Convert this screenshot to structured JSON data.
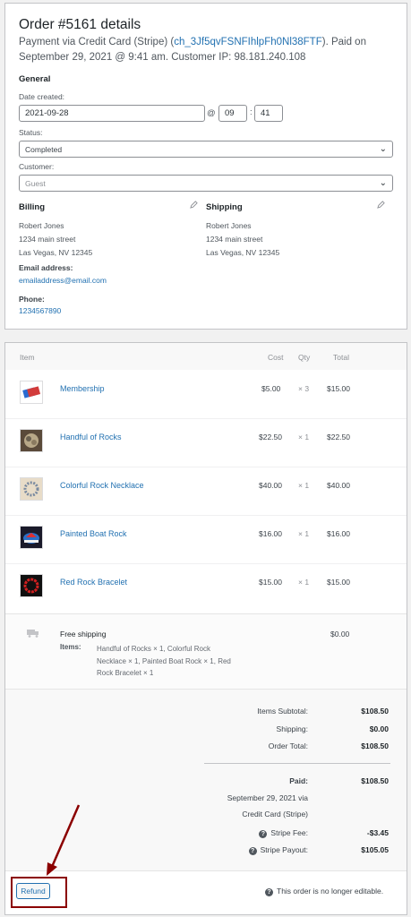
{
  "order": {
    "title": "Order #5161 details",
    "payment_prefix": "Payment via Credit Card (Stripe) (",
    "charge_id": "ch_3Jf5qvFSNFIhlpFh0Nl38FTF",
    "payment_suffix": "). Paid on September 29, 2021 @ 9:41 am. Customer IP: 98.181.240.108"
  },
  "general": {
    "heading": "General",
    "date_label": "Date created:",
    "date_value": "2021-09-28",
    "at": "@",
    "hour": "09",
    "colon": ":",
    "minute": "41",
    "status_label": "Status:",
    "status_value": "Completed",
    "customer_label": "Customer:",
    "customer_value": "Guest"
  },
  "billing": {
    "heading": "Billing",
    "name": "Robert Jones",
    "street": "1234 main street",
    "city": "Las Vegas, NV 12345",
    "email_label": "Email address:",
    "email": "emailaddress@email.com",
    "phone_label": "Phone:",
    "phone": "1234567890"
  },
  "shipping_addr": {
    "heading": "Shipping",
    "name": "Robert Jones",
    "street": "1234 main street",
    "city": "Las Vegas, NV 12345"
  },
  "items_table": {
    "col_item": "Item",
    "col_cost": "Cost",
    "col_qty": "Qty",
    "col_total": "Total",
    "rows": [
      {
        "name": "Membership",
        "cost": "$5.00",
        "qty": "× 3",
        "total": "$15.00"
      },
      {
        "name": "Handful of Rocks",
        "cost": "$22.50",
        "qty": "× 1",
        "total": "$22.50"
      },
      {
        "name": "Colorful Rock Necklace",
        "cost": "$40.00",
        "qty": "× 1",
        "total": "$40.00"
      },
      {
        "name": "Painted Boat Rock",
        "cost": "$16.00",
        "qty": "× 1",
        "total": "$16.00"
      },
      {
        "name": "Red Rock Bracelet",
        "cost": "$15.00",
        "qty": "× 1",
        "total": "$15.00"
      }
    ]
  },
  "shipping_line": {
    "method": "Free shipping",
    "items_label": "Items:",
    "items_lines": [
      "Handful of Rocks × 1, Colorful Rock",
      "Necklace × 1, Painted Boat Rock × 1, Red",
      "Rock Bracelet × 1"
    ],
    "amount": "$0.00"
  },
  "totals": {
    "subtotal_label": "Items Subtotal:",
    "subtotal": "$108.50",
    "shipping_label": "Shipping:",
    "shipping": "$0.00",
    "order_total_label": "Order Total:",
    "order_total": "$108.50",
    "paid_label": "Paid:",
    "paid": "$108.50",
    "paid_note_1": "September 29, 2021 via",
    "paid_note_2": "Credit Card (Stripe)",
    "fee_label": "Stripe Fee:",
    "fee": "-$3.45",
    "payout_label": "Stripe Payout:",
    "payout": "$105.05"
  },
  "footer": {
    "refund": "Refund",
    "not_editable": "This order is no longer editable."
  },
  "colors": {
    "link": "#2271b1",
    "annotation": "#8b0000"
  }
}
